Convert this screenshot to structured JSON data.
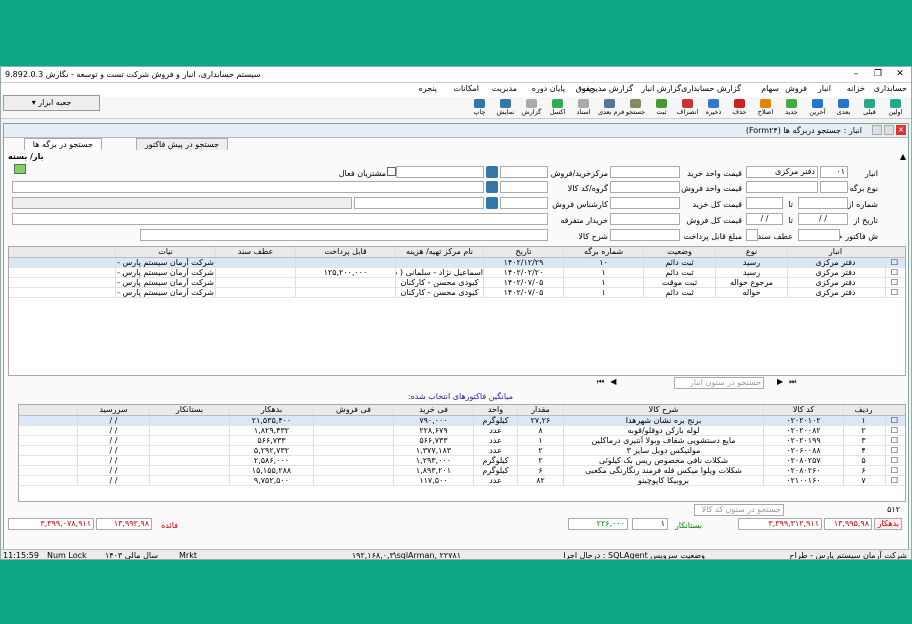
{
  "window": {
    "title": "سیستم حسابداری، انبار و فروش شرکت تست و توسعه - نگارش 9.892.0.3"
  },
  "menu": [
    "حسابداری",
    "خزانه",
    "انبار",
    "فروش",
    "سهام",
    "گزارش حسابداری",
    "گزارش انبار",
    "گزارش مدیریت",
    "حقوق",
    "پایان دوره",
    "مدیریت",
    "امکانات",
    "پنجره"
  ],
  "toolbar": {
    "tools_label": "جعبه ابزار",
    "buttons": [
      "اولین",
      "قبلی",
      "بعدی",
      "آخرین",
      "جدید",
      "اصلاح",
      "حذف",
      "ذخیره",
      "انصراف",
      "ثبت",
      "جستجو",
      "فرم بعدی",
      "اسناد",
      "اکسل",
      "گزارش",
      "نمایش",
      "چاپ"
    ]
  },
  "child": {
    "title": "انبار : جستجو دربرگه ها (Form۲۴)",
    "tabs": [
      "جستجو در برگه ها",
      "جستجو در پیش فاکتور"
    ]
  },
  "filter": {
    "section": "بار/ بسته",
    "anbar_label": "انبار",
    "anbar_code": "۰۱",
    "anbar_name": "دفتر مرکزی",
    "noe_label": "نوع برگه",
    "shomare_label": "شماره از",
    "ta": "تا",
    "tarikh_label": "تاریخ از",
    "date_from": "/ /",
    "date_to": "/ /",
    "sh_factor_label": "ش فاکتور خرید",
    "arz_label": "عطف سند",
    "unit_buy_label": "قیمت واحد خرید",
    "unit_sell_label": "قیمت واحد فروش",
    "total_buy_label": "قیمت کل خرید",
    "total_sell_label": "قیمت کل فروش",
    "pay_label": "مبلغ قابل پرداخت",
    "center_label": "مرکزخرید/فروش",
    "group_label": "گروه/کد کالا",
    "expert_label": "کارشناس فروش",
    "buyer_label": "خریدار متفرقه",
    "desc_label": "شرح کالا",
    "active_customers": "مشتریان فعال"
  },
  "grid1": {
    "headers": [
      "انبار",
      "نوع",
      "وضعیت",
      "شماره برگه",
      "تاریخ",
      "نام مرکز تهیه/ هزینه",
      "قابل پرداخت",
      "عطف سند",
      "نیات"
    ],
    "rows": [
      [
        "دفتر مرکزی",
        "رسید",
        "ثبت دائم",
        "۱۰",
        "۱۴۰۲/۱۲/۲۹",
        "",
        "",
        "",
        "شرکت آرمان سیستم پارس -"
      ],
      [
        "دفتر مرکزی",
        "رسید",
        "ثبت دائم",
        "۱",
        "۱۴۰۲/۰۲/۲۰",
        "اسماعیل نژاد - سلمانی ( شا",
        "۱۲۵,۲۰۰,۰۰۰",
        "",
        "شرکت آرمان سیستم پارس -"
      ],
      [
        "دفتر مرکزی",
        "مرجوع حواله",
        "ثبت موقت",
        "۱",
        "۱۴۰۲/۰۷/۰۵",
        "کیودی محسن - کارکنان",
        "",
        "",
        "شرکت آرمان سیستم پارس -"
      ],
      [
        "دفتر مرکزی",
        "حواله",
        "ثبت دائم",
        "۱",
        "۱۴۰۲/۰۷/۰۵",
        "کیودی محسن - کارکنان",
        "",
        "",
        "شرکت آرمان سیستم پارس -"
      ]
    ],
    "search_placeholder": "جستجو در ستون انبار"
  },
  "avg_label": "میانگین فاکتورهای انتخاب شده:",
  "grid2": {
    "headers": [
      "ردیف",
      "کد کالا",
      "شرح کالا",
      "مقدار",
      "واحد",
      "فی خرید",
      "فی فروش",
      "بدهکار",
      "بستانکار",
      "سررسید"
    ],
    "rows": [
      [
        "۱",
        "۰۲۰۲۰۱۰۲",
        "برنج بره نشان شهرهدا",
        "۲۷,۲۶",
        "کیلوگرم",
        "۷۹۰,۰۰۰",
        "",
        "۲۱,۵۳۵,۴۰۰",
        "",
        "/ /"
      ],
      [
        "۲",
        "۰۲۰۲۰۰۸۲",
        "لوله بازکن دوقلو/قوبه",
        "۸",
        "عدد",
        "۲۲۸,۶۷۹",
        "",
        "۱,۸۲۹,۴۳۲",
        "",
        "/ /"
      ],
      [
        "۳",
        "۰۲۰۲۰۱۹۹",
        "مایع دستشویی شفاف وبولا آنتیری درماکلین",
        "۱",
        "عدد",
        "۵۶۶,۷۳۳",
        "",
        "۵۶۶,۷۳۳",
        "",
        "/ /"
      ],
      [
        "۴",
        "۰۲۰۶۰۰۸۸",
        "مولتیکس دوبل سایز ۳",
        "۲",
        "عدد",
        "۱,۳۷۷,۱۸۳",
        "",
        "۵,۲۹۲,۷۳۲",
        "",
        "/ /"
      ],
      [
        "۵",
        "۰۲۰۸۰۲۵۷",
        "شکلات نافی مخصوص ریس بک کیلوئی",
        "۲",
        "کیلوگرم",
        "۱,۲۹۳,۰۰۰",
        "",
        "۲,۵۸۶,۰۰۰",
        "",
        "/ /"
      ],
      [
        "۶",
        "۰۲۰۸۰۲۶۰",
        "شکلات ویلوا میکس فله فرمند رنگارنگی مکعبی",
        "۶",
        "کیلوگرم",
        "۱,۸۹۳,۲۰۱",
        "",
        "۱۵,۱۵۵,۲۸۸",
        "",
        "/ /"
      ],
      [
        "۷",
        "۰۲۱۰۰۱۶۰",
        "بروبیکا کاپوچینو",
        "۸۲",
        "عدد",
        "۱۱۷,۵۰۰",
        "",
        "۹,۷۵۲,۵۰۰",
        "",
        "/ /"
      ]
    ],
    "count": "۵۱۲",
    "search_placeholder": "جستجو در ستون کد کالا"
  },
  "totals": {
    "bed_label": "بدهکار",
    "bed_value": "۱۳,۹۹۵,۹۸",
    "bed_total": "۳,۳۹۹,۳۱۲,۹۱۱",
    "bes_label": "بستانکار",
    "bes_value": "۱",
    "bes_total": "۲۲۶,۰۰۰",
    "faede_label": "فائده",
    "faede_value": "۱۳,۹۹۲,۹۸",
    "remain": "۳,۳۹۹,۰۷۸,۹۱۱"
  },
  "status": {
    "company": "شرکت آرمان سیستم پارس - طراح",
    "sql": "درحال اجرا : SQLAgent وضعیت سرویس",
    "conn": "۱۹۲,۱۶۸,۰,۳\\sqlArman, ۲۲۷۸۱",
    "mrkt": "Mrkt",
    "year": "سال مالی ۱۴۰۳",
    "numlock": "Num Lock",
    "time": "11:15:59"
  }
}
